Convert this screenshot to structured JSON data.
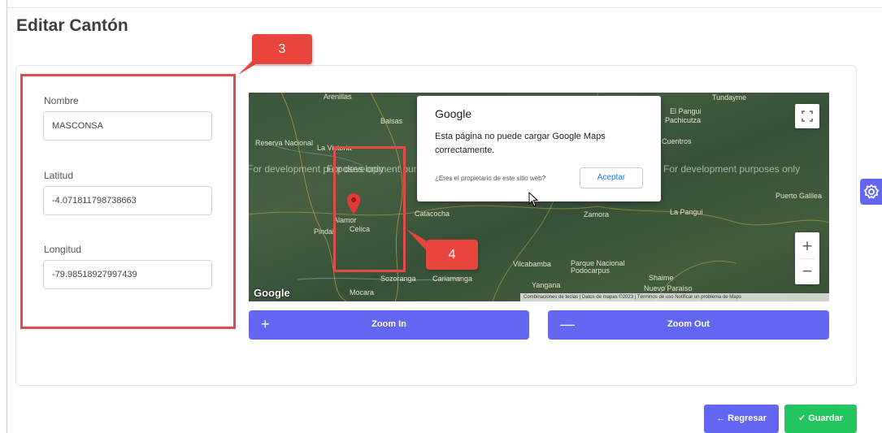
{
  "page": {
    "title": "Editar Cantón"
  },
  "form": {
    "nombre": {
      "label": "Nombre",
      "value": "MASCONSA"
    },
    "latitud": {
      "label": "Latitud",
      "value": "-4.071811798738663"
    },
    "longitud": {
      "label": "Longitud",
      "value": "-79.98518927997439"
    }
  },
  "annotations": {
    "callout_form": "3",
    "callout_map": "4"
  },
  "map": {
    "watermark": "For development purposes only",
    "labels": [
      "Arenillas",
      "Balsas",
      "Reserva Nacional",
      "La Victoria",
      "Catacocha",
      "Celica",
      "Pindal",
      "Sozoranga",
      "Cariamanga",
      "Mocara",
      "Vilcabamba",
      "Yangana",
      "Zamora",
      "La Pangui",
      "Puerto Galilea",
      "El Pangui",
      "Pachicutza",
      "Tundayme",
      "Parque Nacional Podocarpus",
      "Nuevo Paraíso",
      "Shaime",
      "Cuentros",
      "Alamor"
    ],
    "dialog": {
      "title": "Google",
      "message": "Esta página no puede cargar Google Maps correctamente.",
      "question": "¿Eres el propietario de este sitio web?",
      "button": "Aceptar"
    },
    "logo": "Google",
    "attribution": "Combinaciones de teclas | Datos de mapas ©2023 | Términos de uso  Notificar un problema de Maps",
    "zoom_plus": "+",
    "zoom_minus": "−"
  },
  "actions": {
    "zoom_in": {
      "label": "Zoom In",
      "symbol": "+"
    },
    "zoom_out": {
      "label": "Zoom Out",
      "symbol": "—"
    },
    "regresar": "← Regresar",
    "guardar": "✓ Guardar"
  },
  "colors": {
    "primary": "#6366f1",
    "success": "#22c55e",
    "annotation": "#e8453c"
  },
  "icons": {
    "settings": "gear-icon",
    "fullscreen": "fullscreen-icon",
    "pin": "map-pin-icon"
  }
}
